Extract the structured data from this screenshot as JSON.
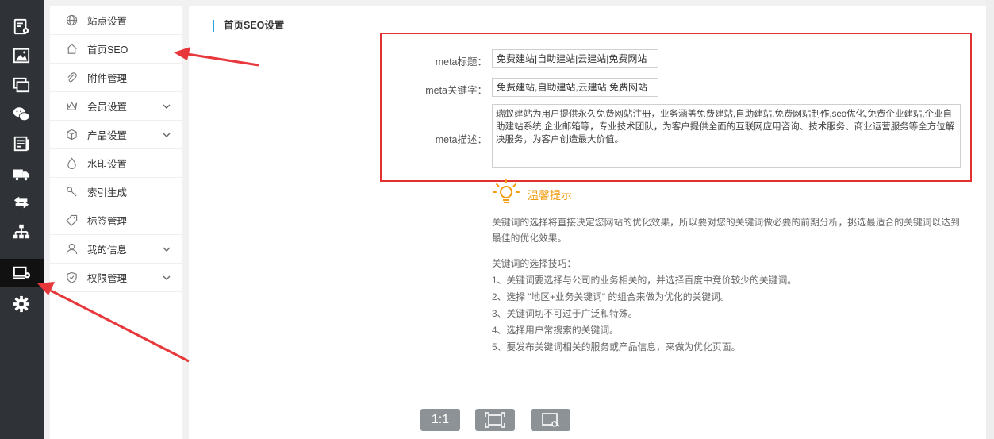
{
  "rail_icons": [
    {
      "name": "form-settings-icon"
    },
    {
      "name": "image-icon"
    },
    {
      "name": "layers-icon"
    },
    {
      "name": "wechat-icon"
    },
    {
      "name": "news-icon"
    },
    {
      "name": "delivery-truck-icon"
    },
    {
      "name": "exchange-arrows-icon"
    },
    {
      "name": "sitemap-icon"
    },
    {
      "name": "site-settings-icon",
      "active": true
    },
    {
      "name": "gear-icon"
    }
  ],
  "subnav": {
    "items": [
      {
        "label": "站点设置",
        "icon": "globe-icon"
      },
      {
        "label": "首页SEO",
        "icon": "home-icon"
      },
      {
        "label": "附件管理",
        "icon": "paperclip-icon"
      },
      {
        "label": "会员设置",
        "icon": "crown-icon",
        "expandable": true
      },
      {
        "label": "产品设置",
        "icon": "cube-icon",
        "expandable": true
      },
      {
        "label": "水印设置",
        "icon": "droplet-icon"
      },
      {
        "label": "索引生成",
        "icon": "index-icon"
      },
      {
        "label": "标签管理",
        "icon": "tag-icon"
      },
      {
        "label": "我的信息",
        "icon": "user-icon",
        "expandable": true
      },
      {
        "label": "权限管理",
        "icon": "shield-icon",
        "expandable": true
      }
    ]
  },
  "main": {
    "title": "首页SEO设置",
    "fields": {
      "meta_title_label": "meta标题：",
      "meta_title_value": "免费建站|自助建站|云建站|免费网站",
      "meta_keywords_label": "meta关键字：",
      "meta_keywords_value": "免费建站,自助建站,云建站,免费网站",
      "meta_desc_label": "meta描述：",
      "meta_desc_value": "瑞蚁建站为用户提供永久免费网站注册，业务涵盖免费建站,自助建站,免费网站制作,seo优化,免费企业建站,企业自助建站系统,企业邮箱等，专业技术团队，为客户提供全面的互联网应用咨询、技术服务、商业运营服务等全方位解决服务，为客户创造最大价值。"
    },
    "tips": {
      "title": "温馨提示",
      "intro": "关键词的选择将直接决定您网站的优化效果，所以要对您的关键词做必要的前期分析，挑选最适合的关键词以达到最佳的优化效果。",
      "skills_title": "关键词的选择技巧：",
      "skills": [
        "1、关键词要选择与公司的业务相关的，并选择百度中竞价较少的关键词。",
        "2、选择 \"地区+业务关键词\" 的组合来做为优化的关键词。",
        "3、关键词切不可过于广泛和特殊。",
        "4、选择用户常搜索的关键词。",
        "5、要发布关键词相关的服务或产品信息，来做为优化页面。"
      ]
    }
  },
  "bottom_toolbar": {
    "actual_size_label": "1:1"
  },
  "colors": {
    "rail_bg": "#2f3338",
    "accent_blue": "#2aa3e6",
    "highlight_red": "#e03030",
    "tips_orange": "#f39c11"
  }
}
